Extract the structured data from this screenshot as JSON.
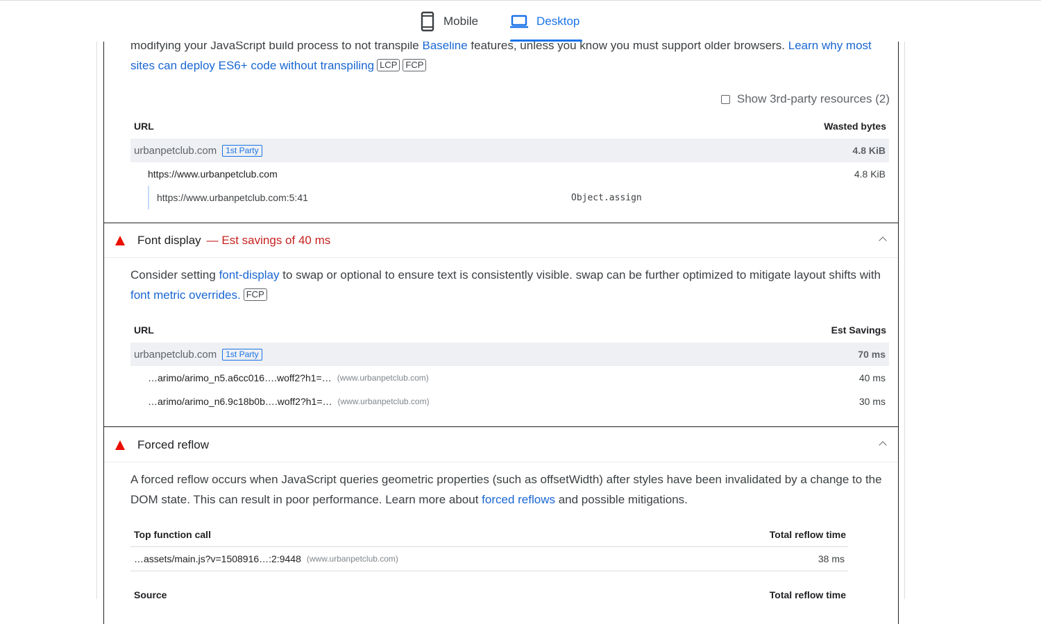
{
  "tabs": {
    "mobile_label": "Mobile",
    "desktop_label": "Desktop",
    "active": "Desktop"
  },
  "legacy_js": {
    "para_text_1": "modifying your JavaScript build process to not transpile ",
    "baseline_link": "Baseline",
    "para_text_2": " features, unless you know you must support older browsers. ",
    "learn_link": "Learn why most sites can deploy ES6+ code without transpiling",
    "badge_lcp": "LCP",
    "badge_fcp": "FCP",
    "show_third_party": "Show 3rd-party resources (2)",
    "col_url": "URL",
    "col_wasted": "Wasted bytes",
    "rows": [
      {
        "label": "urbanpetclub.com",
        "party": "1st Party",
        "value": "4.8 KiB"
      },
      {
        "label": "https://www.urbanpetclub.com",
        "value": "4.8 KiB"
      },
      {
        "label": "https://www.urbanpetclub.com:5:41",
        "code": "Object.assign"
      }
    ]
  },
  "font_display": {
    "title": "Font display",
    "savings": "— Est savings of 40 ms",
    "para_text_1": "Consider setting ",
    "font_display_link": "font-display",
    "para_text_2": " to swap or optional to ensure text is consistently visible. swap can be further optimized to mitigate layout shifts with ",
    "overrides_link": "font metric overrides.",
    "badge_fcp": "FCP",
    "col_url": "URL",
    "col_savings": "Est Savings",
    "group": {
      "label": "urbanpetclub.com",
      "party": "1st Party",
      "value": "70 ms"
    },
    "items": [
      {
        "file": "…arimo/arimo_n5.a6cc016….woff2?h1=…",
        "host": "(www.urbanpetclub.com)",
        "value": "40 ms"
      },
      {
        "file": "…arimo/arimo_n6.9c18b0b….woff2?h1=…",
        "host": "(www.urbanpetclub.com)",
        "value": "30 ms"
      }
    ]
  },
  "forced_reflow": {
    "title": "Forced reflow",
    "para_text_1": "A forced reflow occurs when JavaScript queries geometric properties (such as offsetWidth) after styles have been invalidated by a change to the DOM state. This can result in poor performance. Learn more about ",
    "reflow_link": "forced reflows",
    "para_text_2": " and possible mitigations.",
    "col_top_call": "Top function call",
    "col_total": "Total reflow time",
    "top_row": {
      "file": "…assets/main.js?v=1508916…:2:9448",
      "host": "(www.urbanpetclub.com)",
      "value": "38 ms"
    },
    "col_source": "Source",
    "col_total_2": "Total reflow time"
  },
  "colors": {
    "accent": "#1a73e8",
    "warning": "#eb0f00",
    "savings": "#c5221f",
    "row_shade": "#eef0f3"
  }
}
